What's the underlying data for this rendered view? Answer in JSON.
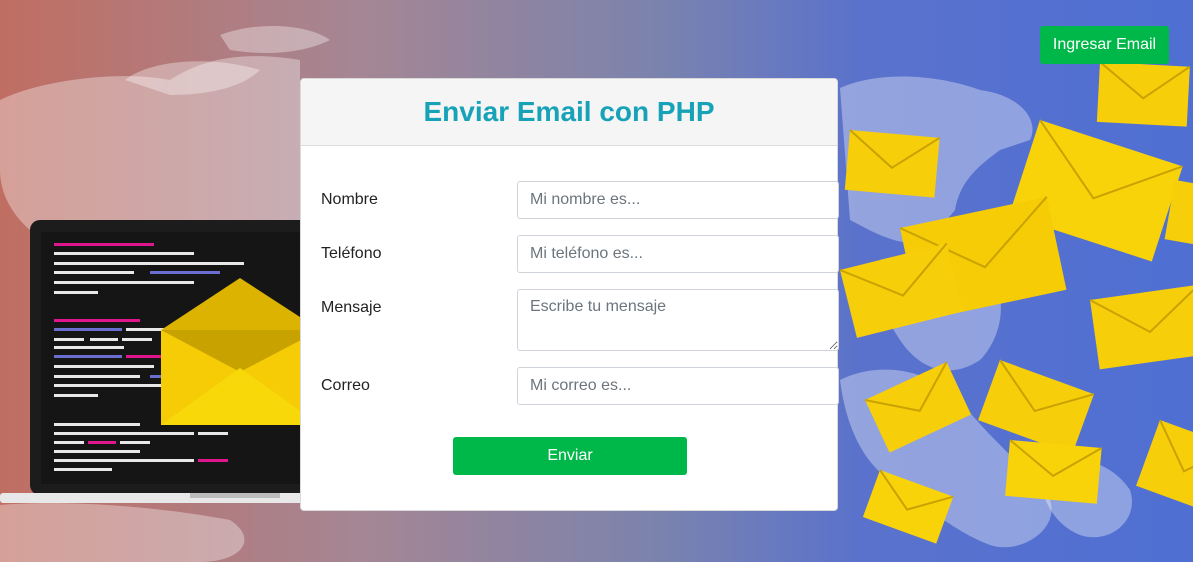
{
  "header": {
    "login_label": "Ingresar Email"
  },
  "form": {
    "title": "Enviar Email con PHP",
    "fields": {
      "nombre": {
        "label": "Nombre",
        "placeholder": "Mi nombre es..."
      },
      "telefono": {
        "label": "Teléfono",
        "placeholder": "Mi teléfono es..."
      },
      "mensaje": {
        "label": "Mensaje",
        "placeholder": "Escribe tu mensaje"
      },
      "correo": {
        "label": "Correo",
        "placeholder": "Mi correo es..."
      }
    },
    "submit_label": "Enviar"
  },
  "colors": {
    "accent_title": "#17a2b8",
    "button_green": "#00b84a",
    "envelope_yellow": "#f7ce0a"
  },
  "icons": [
    "laptop-code-illustration",
    "envelope-icon",
    "world-map-background"
  ]
}
